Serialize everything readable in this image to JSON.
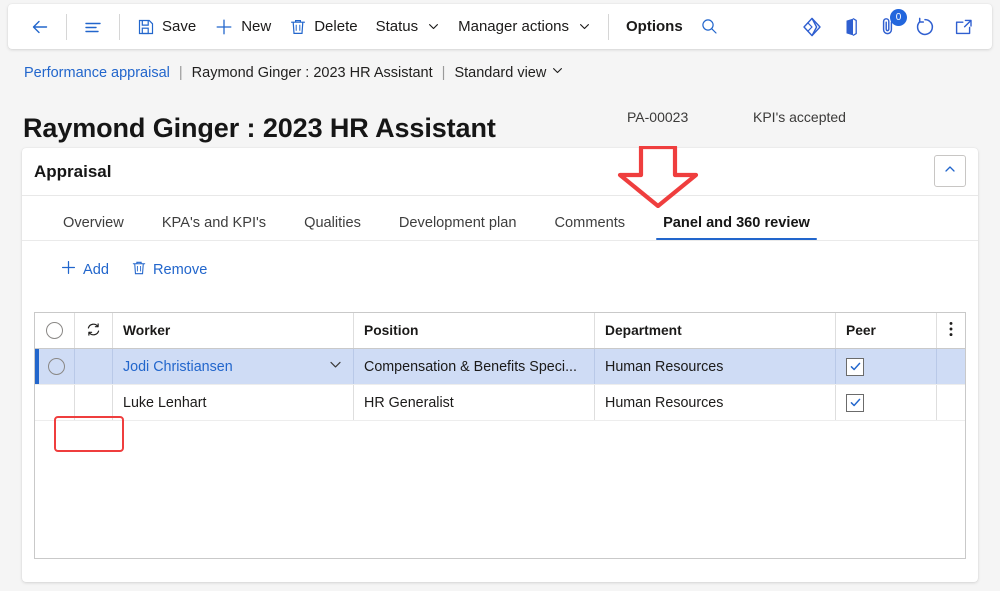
{
  "toolbar": {
    "back_label": "Back",
    "menu_label": "Show navigation menu",
    "save_label": "Save",
    "new_label": "New",
    "delete_label": "Delete",
    "status_label": "Status",
    "manager_actions_label": "Manager actions",
    "options_label": "Options",
    "search_label": "Search",
    "diamond_label": "Personalize",
    "office_label": "Open in Microsoft Office",
    "attachments_label": "Attachments",
    "attachments_count": "0",
    "refresh_label": "Refresh",
    "popout_label": "Open in new window",
    "accent_color": "#2266cc"
  },
  "breadcrumb": {
    "module": "Performance appraisal",
    "separator": "|",
    "record": "Raymond Ginger : 2023 HR Assistant",
    "view": "Standard view"
  },
  "page": {
    "title": "Raymond Ginger : 2023 HR Assistant",
    "record_id": "PA-00023",
    "status": "KPI's accepted"
  },
  "card": {
    "title": "Appraisal",
    "collapse_label": "Collapse"
  },
  "tabs": [
    {
      "label": "Overview",
      "active": false
    },
    {
      "label": "KPA's and KPI's",
      "active": false
    },
    {
      "label": "Qualities",
      "active": false
    },
    {
      "label": "Development plan",
      "active": false
    },
    {
      "label": "Comments",
      "active": false
    },
    {
      "label": "Panel and 360 review",
      "active": true
    }
  ],
  "grid_toolbar": {
    "add_label": "Add",
    "remove_label": "Remove"
  },
  "grid": {
    "columns": [
      {
        "key": "select",
        "label": ""
      },
      {
        "key": "ref",
        "label": ""
      },
      {
        "key": "worker",
        "label": "Worker"
      },
      {
        "key": "position",
        "label": "Position"
      },
      {
        "key": "department",
        "label": "Department"
      },
      {
        "key": "peer",
        "label": "Peer"
      }
    ],
    "rows": [
      {
        "selected": true,
        "worker": "Jodi Christiansen",
        "position": "Compensation & Benefits Speci...",
        "department": "Human Resources",
        "peer_checked": true
      },
      {
        "selected": false,
        "worker": "Luke Lenhart",
        "position": "HR Generalist",
        "department": "Human Resources",
        "peer_checked": true
      }
    ]
  },
  "annotations": {
    "arrow_color": "#ef3e3e",
    "arrow_target": "Panel and 360 review",
    "box_color": "#ef3e3e",
    "box_target": "Add"
  }
}
